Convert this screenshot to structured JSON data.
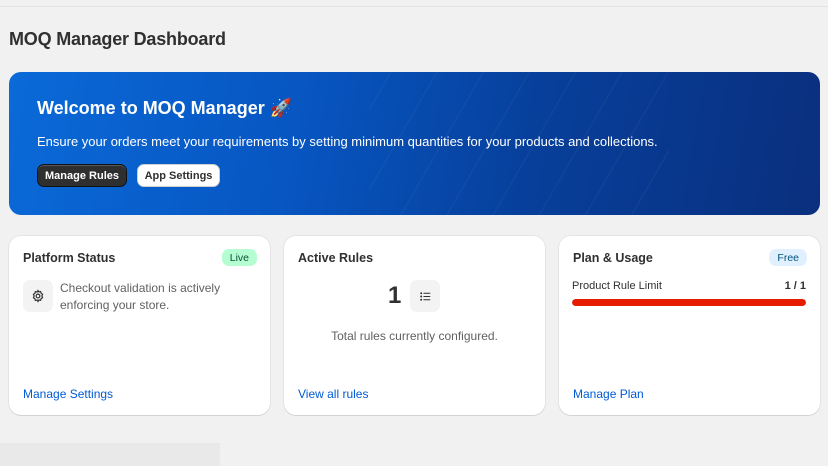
{
  "page": {
    "title": "MOQ Manager Dashboard"
  },
  "banner": {
    "title": "Welcome to MOQ Manager 🚀",
    "description": "Ensure your orders meet your requirements by setting minimum quantities for your products and collections.",
    "primary_button": "Manage Rules",
    "secondary_button": "App Settings",
    "gradient_start": "#0a6ad8",
    "gradient_end": "#0a2f7e"
  },
  "platform_status": {
    "title": "Platform Status",
    "badge": "Live",
    "icon": "gear-icon",
    "message": "Checkout validation is actively enforcing your store.",
    "link": "Manage Settings"
  },
  "active_rules": {
    "title": "Active Rules",
    "count": "1",
    "icon": "list-icon",
    "caption": "Total rules currently configured.",
    "link": "View all rules"
  },
  "plan_usage": {
    "title": "Plan & Usage",
    "badge": "Free",
    "usage_label": "Product Rule Limit",
    "usage_value": "1 / 1",
    "usage_fraction": 1.0,
    "usage_color": "#e51c00",
    "link": "Manage Plan"
  },
  "colors": {
    "link": "#005bd3",
    "live_badge": "#b4fed2",
    "free_badge": "#e0f0ff"
  }
}
